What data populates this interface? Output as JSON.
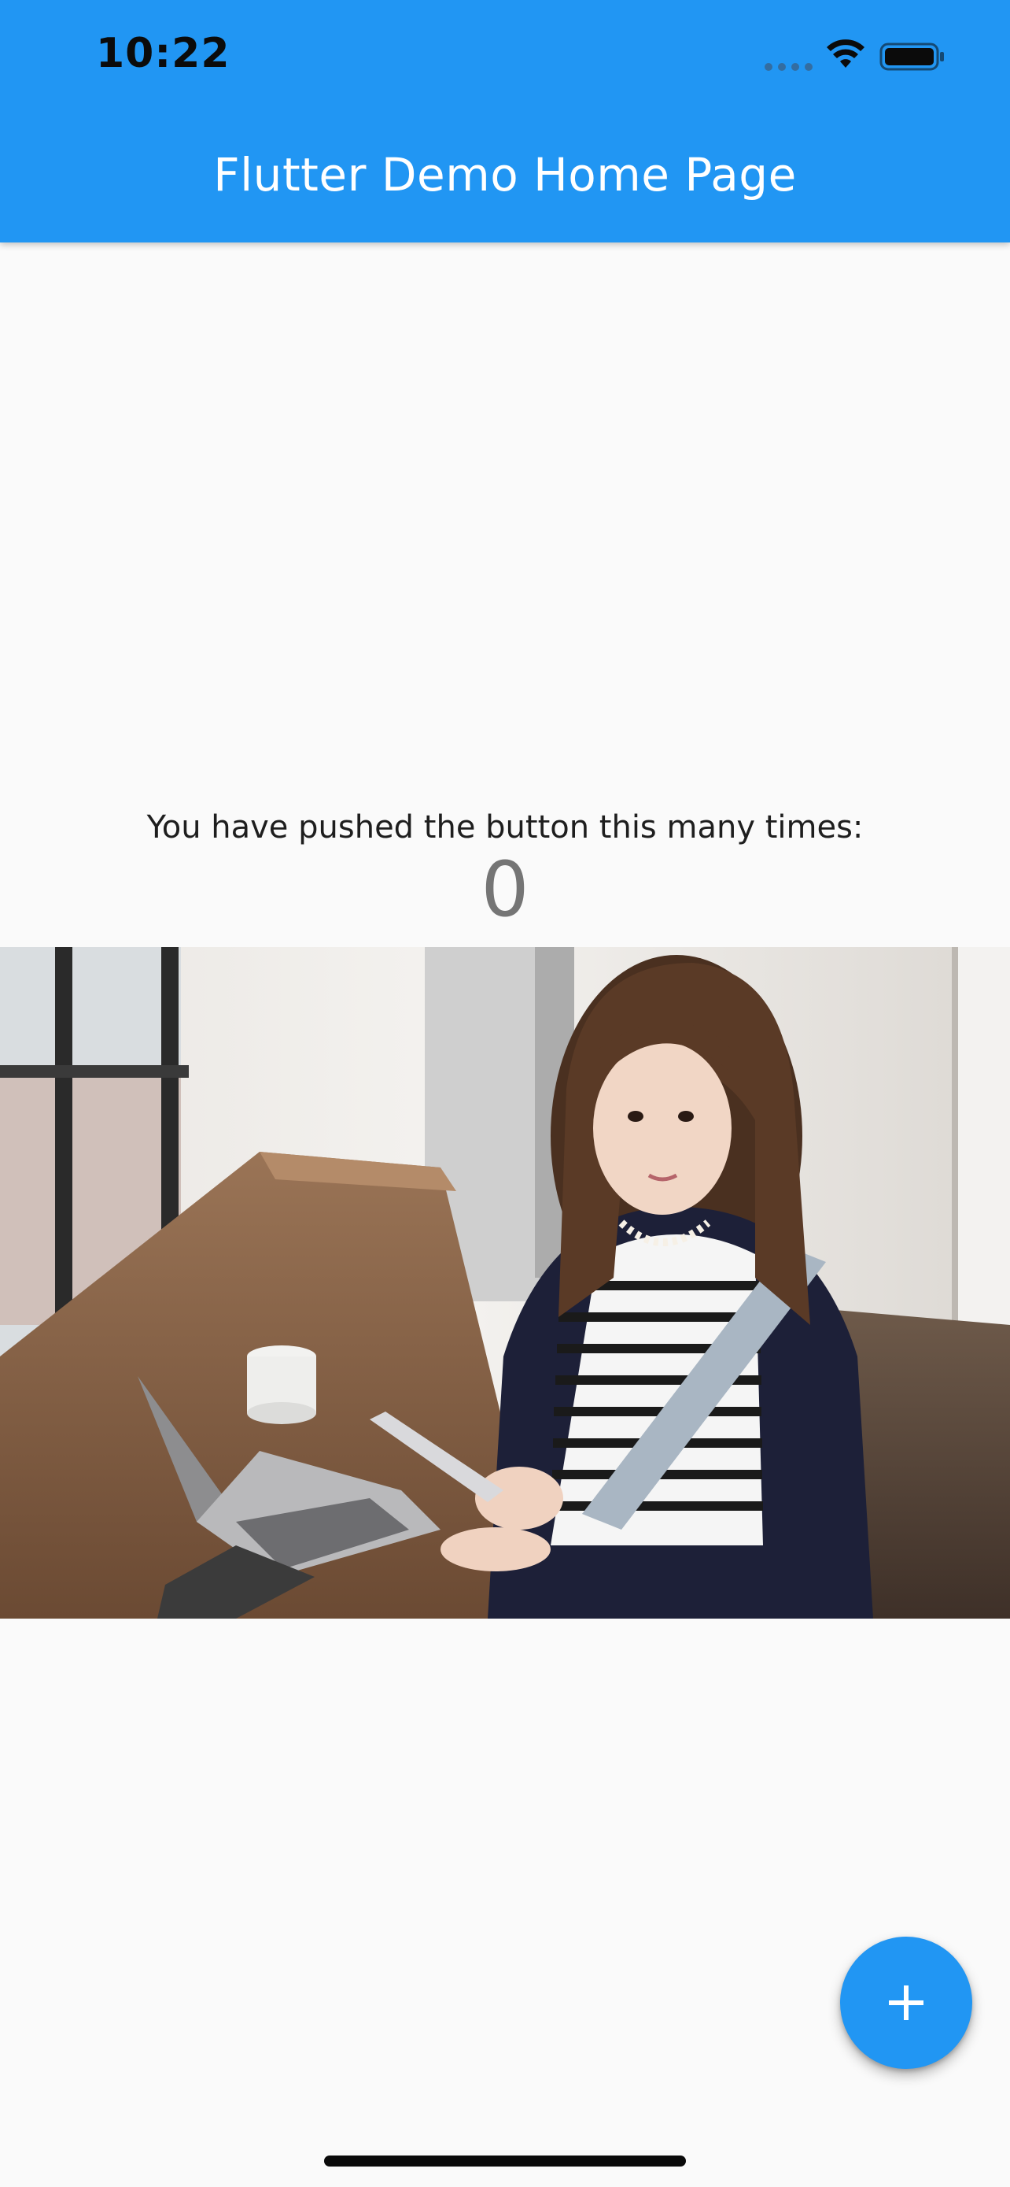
{
  "status_bar": {
    "time": "10:22",
    "signal_icon": "cellular-signal-icon",
    "wifi_icon": "wifi-icon",
    "battery_icon": "battery-icon"
  },
  "app_bar": {
    "title": "Flutter Demo Home Page",
    "background_color": "#2196f3"
  },
  "counter": {
    "label": "You have pushed the button this many times:",
    "value": "0"
  },
  "image": {
    "alt": "Woman holding a smartphone at a cafe table with a laptop"
  },
  "fab": {
    "icon": "add-icon",
    "color": "#2196f3"
  }
}
